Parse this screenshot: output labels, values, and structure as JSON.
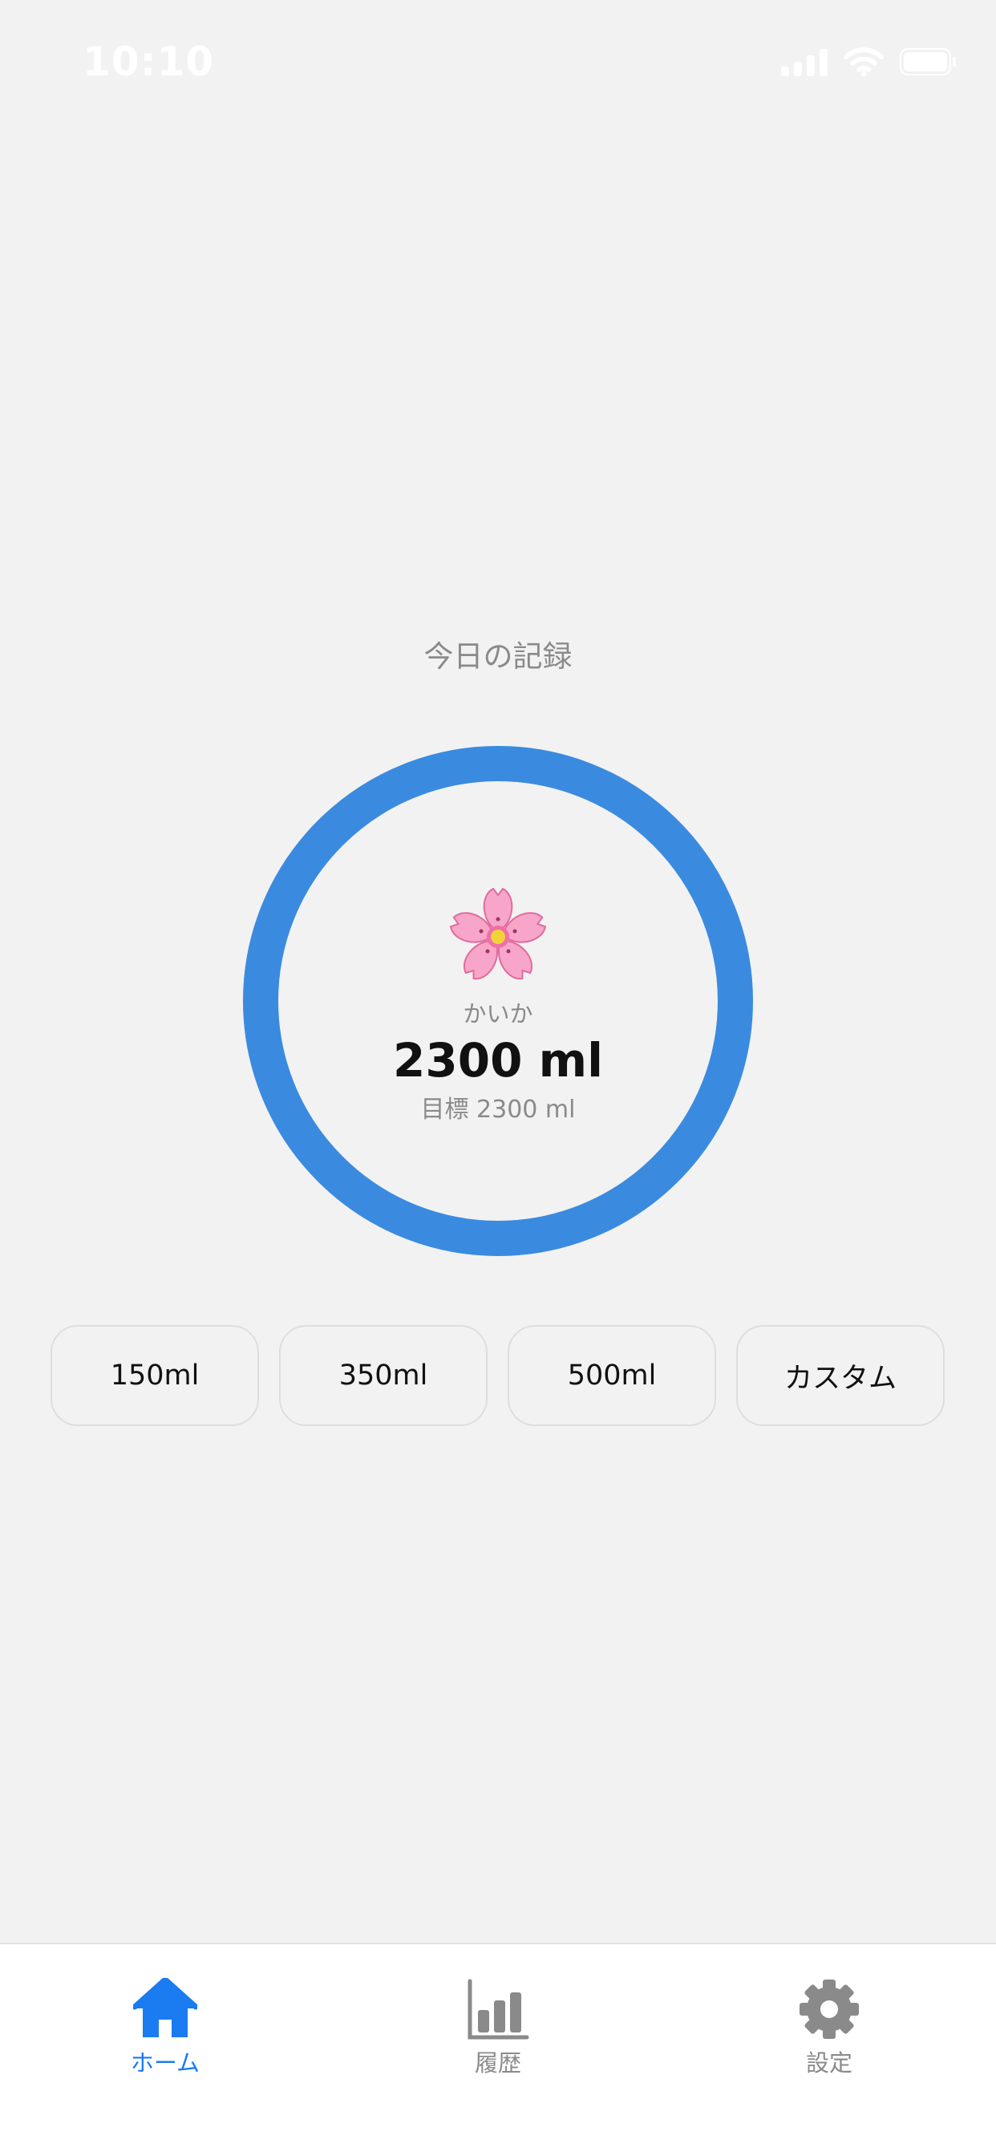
{
  "status_bar": {
    "time": "10:10"
  },
  "home": {
    "section_title": "今日の記録",
    "ring": {
      "name": "かいか",
      "amount": "2300 ml",
      "goal": "目標 2300 ml",
      "progress": 1.0,
      "color": "#3a8be0",
      "icon": "cherry-blossom-icon"
    },
    "quick_add": [
      {
        "label": "150ml"
      },
      {
        "label": "350ml"
      },
      {
        "label": "500ml"
      },
      {
        "label": "カスタム"
      }
    ]
  },
  "tab_bar": {
    "items": [
      {
        "label": "ホーム",
        "icon": "home-icon",
        "active": true
      },
      {
        "label": "履歴",
        "icon": "bar-chart-icon",
        "active": false
      },
      {
        "label": "設定",
        "icon": "gear-icon",
        "active": false
      }
    ],
    "active_color": "#1a7cf0",
    "inactive_color": "#8a8a8a"
  }
}
